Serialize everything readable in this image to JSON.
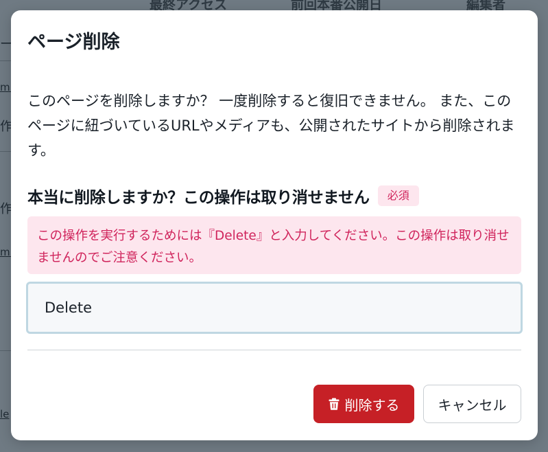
{
  "background": {
    "column_headers": [
      "最終アクセス",
      "前回本番公開日",
      "編集者"
    ],
    "fragments": [
      "ー",
      "ml",
      "作",
      "ml",
      "作",
      "ml",
      "le"
    ]
  },
  "modal": {
    "title": "ページ削除",
    "description": "このページを削除しますか？ 一度削除すると復旧できません。 また、このページに紐づいているURLやメディアも、公開されたサイトから削除されます。",
    "field_label": "本当に削除しますか？この操作は取り消せません",
    "required_badge": "必須",
    "warning": "この操作を実行するためには『Delete』と入力してください。この操作は取り消せませんのでご注意ください。",
    "input_value": "Delete",
    "delete_button_label": "削除する",
    "cancel_button_label": "キャンセル"
  },
  "icons": {
    "delete_button_icon": "trash-icon"
  },
  "colors": {
    "backdrop": "#6f7a83",
    "danger": "#c62026",
    "warning_text": "#d0245c",
    "warning_bg": "#fde6ee",
    "input_border": "#bfd7e2"
  }
}
